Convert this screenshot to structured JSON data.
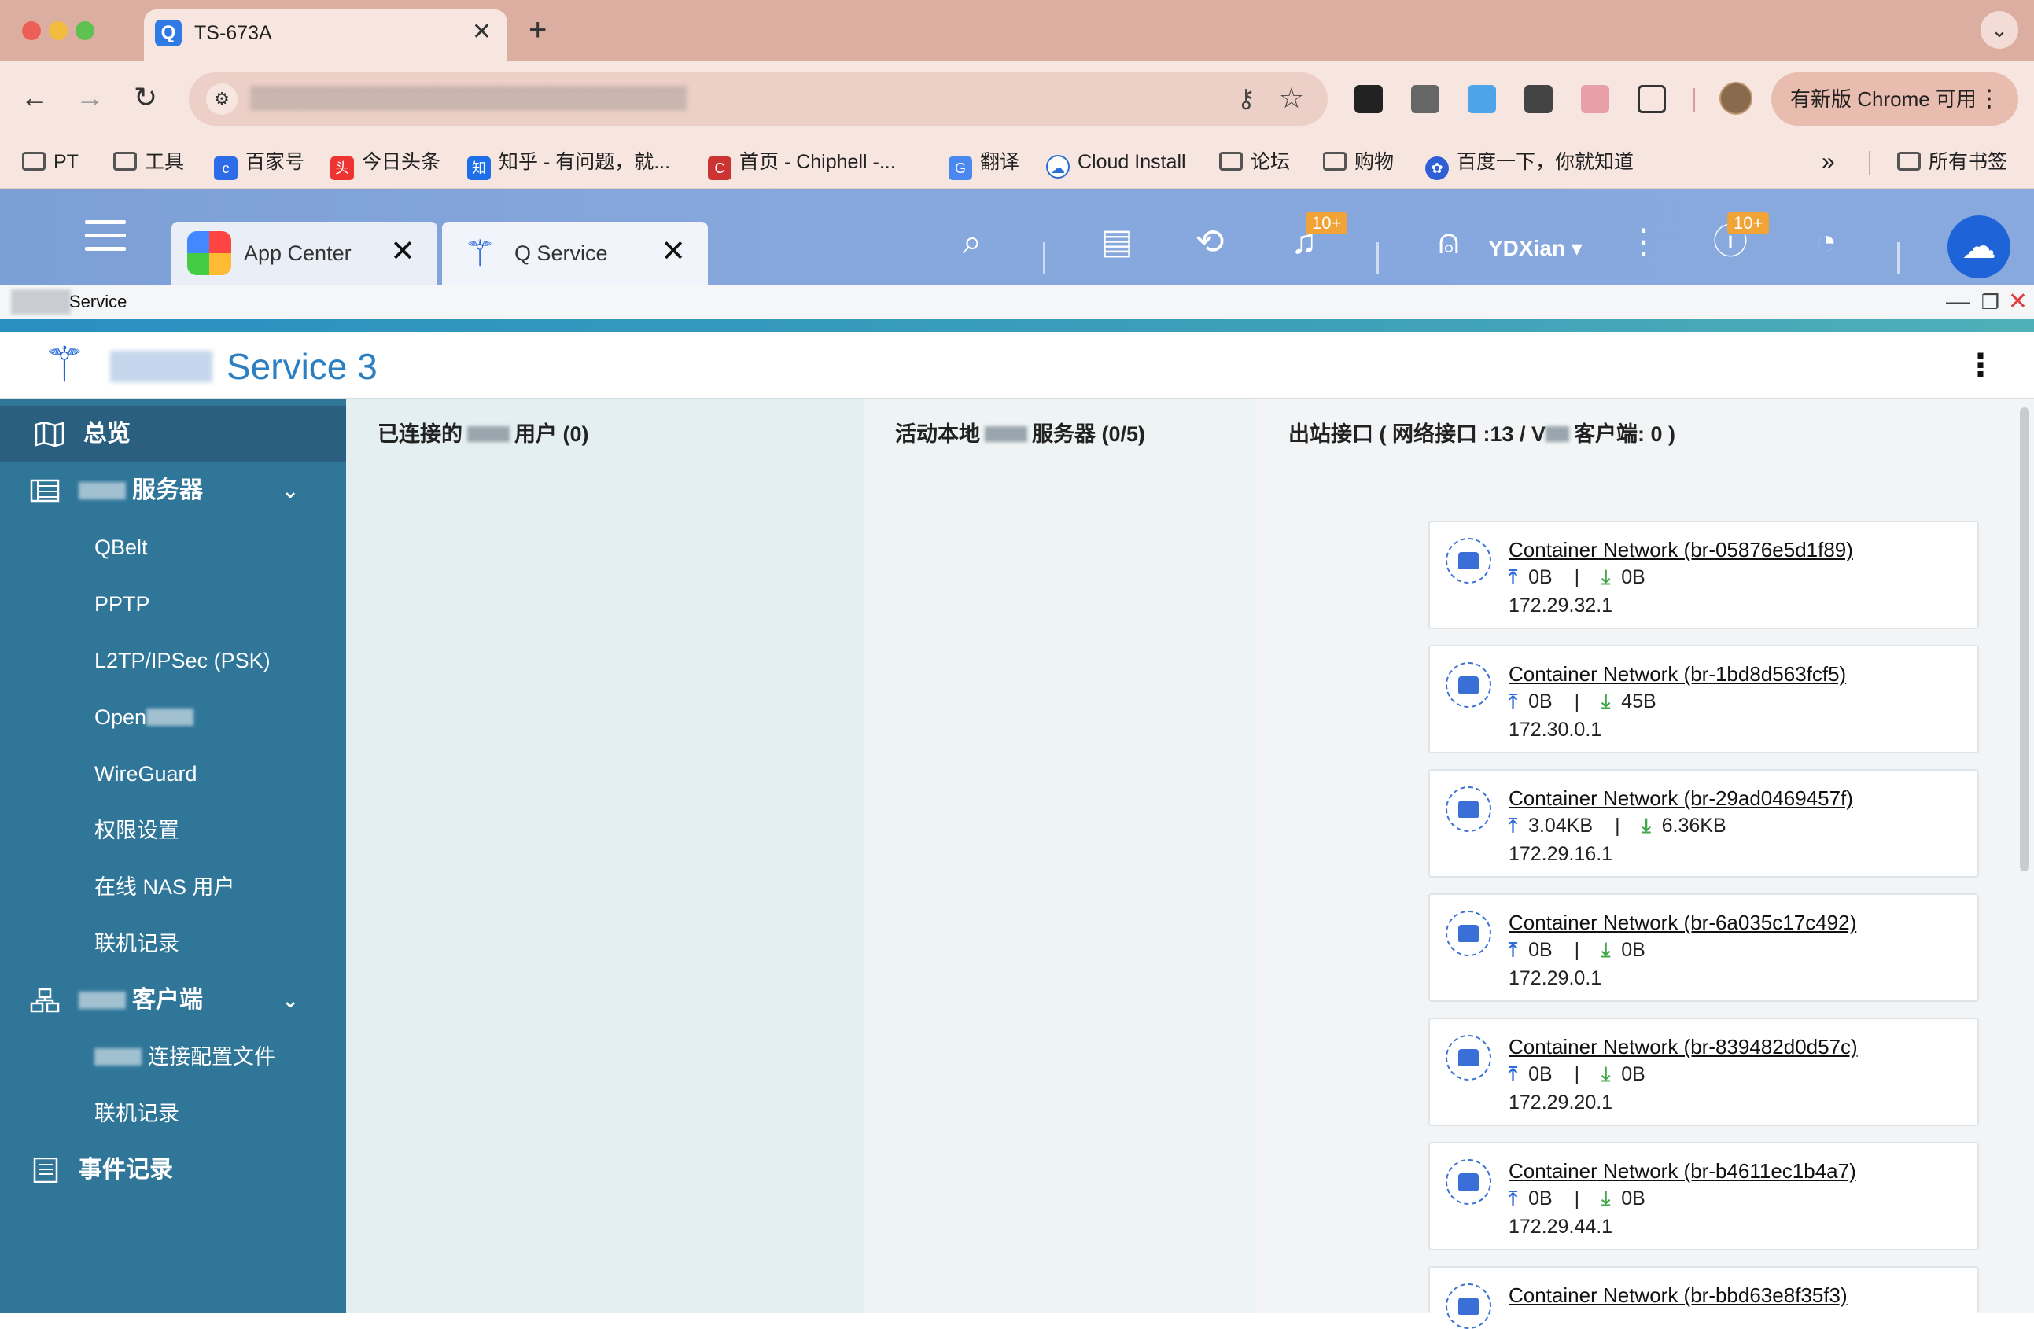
{
  "browser": {
    "tab_title": "TS-673A",
    "tab_close": "✕",
    "new_tab": "+",
    "update_button": "有新版 Chrome 可用",
    "bookmarks": [
      {
        "label": "PT",
        "icon": "folder-icon"
      },
      {
        "label": "工具",
        "icon": "folder-icon"
      },
      {
        "label": "百家号",
        "icon": "baijiahao-icon"
      },
      {
        "label": "今日头条",
        "icon": "toutiao-icon"
      },
      {
        "label": "知乎 - 有问题，就...",
        "icon": "zhihu-icon"
      },
      {
        "label": "首页 - Chiphell -...",
        "icon": "chiphell-icon"
      },
      {
        "label": "翻译",
        "icon": "translate-icon"
      },
      {
        "label": "Cloud Install",
        "icon": "cloud-icon"
      },
      {
        "label": "论坛",
        "icon": "folder-icon"
      },
      {
        "label": "购物",
        "icon": "folder-icon"
      },
      {
        "label": "百度一下，你就知道",
        "icon": "baidu-icon"
      }
    ],
    "more_bookmarks": "»",
    "all_bookmarks": "所有书签"
  },
  "qts": {
    "tabs": [
      {
        "label": "App Center"
      },
      {
        "label": "Q     Service"
      }
    ],
    "notif_badge": "10+",
    "info_badge": "10+",
    "user": "YDXian ▾"
  },
  "window": {
    "title": "Service"
  },
  "app": {
    "title": "Service 3"
  },
  "sidebar": {
    "overview": "总览",
    "vpn_server": "服务器",
    "server_items": [
      "QBelt",
      "PPTP",
      "L2TP/IPSec (PSK)",
      "Open",
      "WireGuard",
      "权限设置",
      "在线 NAS 用户",
      "联机记录"
    ],
    "vpn_client": "客户端",
    "client_items": [
      "连接配置文件",
      "联机记录"
    ],
    "event_log": "事件记录"
  },
  "panels": {
    "connected_prefix": "已连接的",
    "connected_suffix": "用户 (0)",
    "active_prefix": "活动本地",
    "active_suffix": "服务器 (0/5)",
    "outbound_prefix": "出站接口 ( 网络接口 :13 / V",
    "outbound_suffix": "客户端: 0 )"
  },
  "interfaces": [
    {
      "name": "Container Network (br-05876e5d1f89)",
      "up": "0B",
      "down": "0B",
      "ip": "172.29.32.1"
    },
    {
      "name": "Container Network (br-1bd8d563fcf5)",
      "up": "0B",
      "down": "45B",
      "ip": "172.30.0.1"
    },
    {
      "name": "Container Network (br-29ad0469457f)",
      "up": "3.04KB",
      "down": "6.36KB",
      "ip": "172.29.16.1"
    },
    {
      "name": "Container Network (br-6a035c17c492)",
      "up": "0B",
      "down": "0B",
      "ip": "172.29.0.1"
    },
    {
      "name": "Container Network (br-839482d0d57c)",
      "up": "0B",
      "down": "0B",
      "ip": "172.29.20.1"
    },
    {
      "name": "Container Network (br-b4611ec1b4a7)",
      "up": "0B",
      "down": "0B",
      "ip": "172.29.44.1"
    },
    {
      "name": "Container Network (br-bbd63e8f35f3)",
      "up": "",
      "down": "",
      "ip": ""
    }
  ],
  "colors": {
    "sidebar": "#2f7699",
    "sidebar_active": "#2b5f80",
    "accent": "#2c7fc1",
    "upload": "#2f6bd8",
    "download": "#41a64a"
  }
}
